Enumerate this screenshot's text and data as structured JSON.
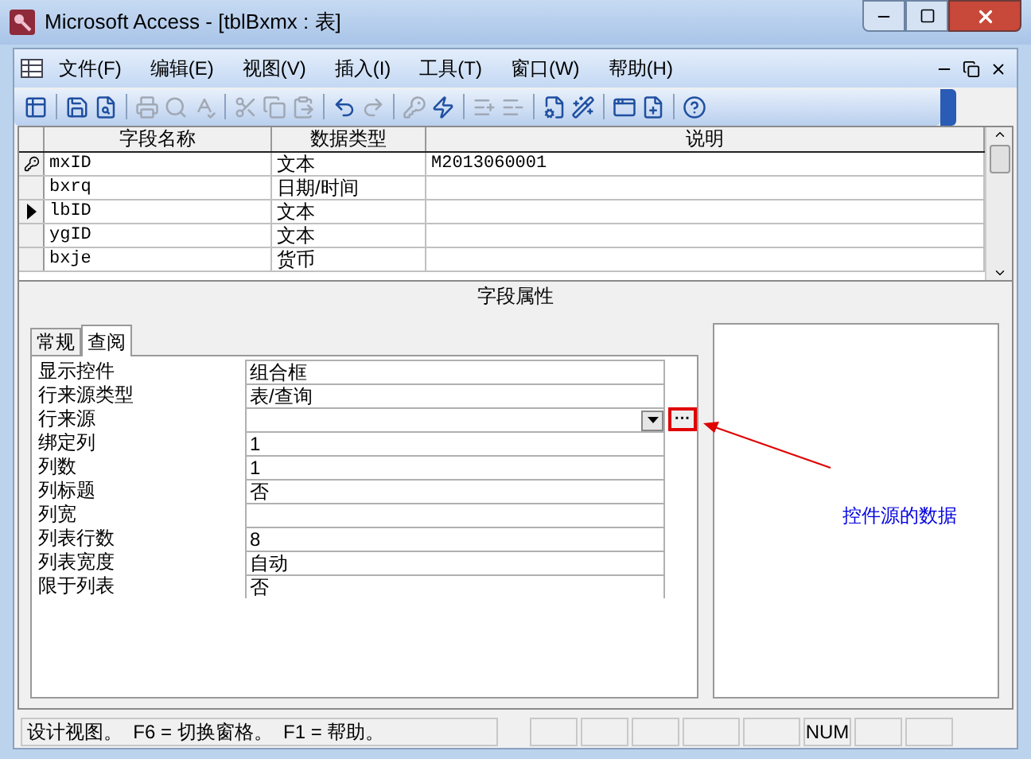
{
  "window": {
    "title": "Microsoft Access - [tblBxmx : 表]"
  },
  "menu": [
    "文件(F)",
    "编辑(E)",
    "视图(V)",
    "插入(I)",
    "工具(T)",
    "窗口(W)",
    "帮助(H)"
  ],
  "toolbar": [
    {
      "kind": "grid",
      "disabled": false
    },
    {
      "kind": "sep"
    },
    {
      "kind": "save",
      "disabled": false
    },
    {
      "kind": "preview",
      "disabled": false
    },
    {
      "kind": "sep"
    },
    {
      "kind": "print",
      "disabled": true
    },
    {
      "kind": "search",
      "disabled": true
    },
    {
      "kind": "spell",
      "disabled": true
    },
    {
      "kind": "sep"
    },
    {
      "kind": "cut",
      "disabled": true
    },
    {
      "kind": "copy",
      "disabled": true
    },
    {
      "kind": "paste",
      "disabled": true
    },
    {
      "kind": "sep"
    },
    {
      "kind": "undo",
      "disabled": false
    },
    {
      "kind": "redo",
      "disabled": true
    },
    {
      "kind": "sep"
    },
    {
      "kind": "key",
      "disabled": true
    },
    {
      "kind": "lightning",
      "disabled": false
    },
    {
      "kind": "sep"
    },
    {
      "kind": "insert-row",
      "disabled": true
    },
    {
      "kind": "delete-row",
      "disabled": true
    },
    {
      "kind": "sep"
    },
    {
      "kind": "properties",
      "disabled": false
    },
    {
      "kind": "build",
      "disabled": false
    },
    {
      "kind": "sep"
    },
    {
      "kind": "window",
      "disabled": false
    },
    {
      "kind": "new-object",
      "disabled": false
    },
    {
      "kind": "sep"
    },
    {
      "kind": "help",
      "disabled": false
    }
  ],
  "grid": {
    "columns": [
      "字段名称",
      "数据类型",
      "说明"
    ],
    "rows": [
      {
        "name": "mxID",
        "type": "文本",
        "description": "M2013060001",
        "primary_key": true,
        "current": false
      },
      {
        "name": "bxrq",
        "type": "日期/时间",
        "primary_key": false,
        "current": false
      },
      {
        "name": "lbID",
        "type": "文本",
        "primary_key": false,
        "current": true
      },
      {
        "name": "ygID",
        "type": "文本",
        "primary_key": false,
        "current": false
      },
      {
        "name": "bxje",
        "type": "货币",
        "primary_key": false,
        "current": false
      }
    ]
  },
  "field_properties": {
    "title": "字段属性",
    "tabs": [
      {
        "label": "常规",
        "selected": false
      },
      {
        "label": "查阅",
        "selected": true
      }
    ],
    "properties": [
      {
        "label": "显示控件",
        "value": "组合框"
      },
      {
        "label": "行来源类型",
        "value": "表/查询"
      },
      {
        "label": "行来源",
        "dropdown": true,
        "builder": "···"
      },
      {
        "label": "绑定列",
        "value": "1"
      },
      {
        "label": "列数",
        "value": "1"
      },
      {
        "label": "列标题",
        "value": "否"
      },
      {
        "label": "列宽"
      },
      {
        "label": "列表行数",
        "value": "8"
      },
      {
        "label": "列表宽度",
        "value": "自动"
      },
      {
        "label": "限于列表",
        "value": "否"
      }
    ],
    "annotation": "控件源的数据"
  },
  "status_bar": {
    "message": "设计视图。  F6 = 切换窗格。  F1 = 帮助。",
    "indicators": [
      {
        "kind": "blank"
      },
      {
        "kind": "blank"
      },
      {
        "kind": "blank"
      },
      {
        "kind": "blank"
      },
      {
        "kind": "blank"
      },
      {
        "kind": "text",
        "text": "NUM"
      },
      {
        "kind": "blank"
      },
      {
        "kind": "blank"
      }
    ]
  }
}
